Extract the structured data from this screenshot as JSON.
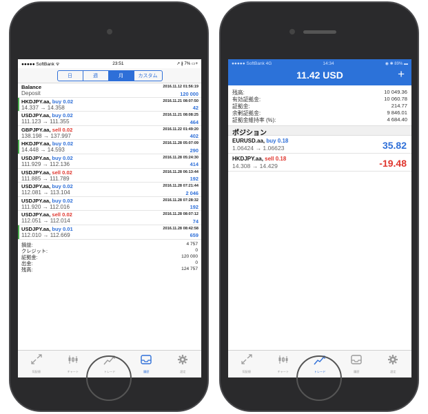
{
  "left": {
    "status": {
      "carrier": "●●●●● SoftBank ᯤ",
      "time": "23:51",
      "right": "↗ ∦ 7% ▭+"
    },
    "segments": [
      "日",
      "週",
      "月",
      "カスタム"
    ],
    "segment_active": 2,
    "balance": {
      "title": "Balance",
      "date": "2016.11.12 01:56:19",
      "sub": "Deposit",
      "amount": "120 000"
    },
    "trades": [
      {
        "sym": "HKDJPY.aa,",
        "side": "buy 0.02",
        "dir": "buy",
        "date": "2016.11.21 08:07:50",
        "prices": "14.337 → 14.358",
        "amt": "42",
        "mark": true
      },
      {
        "sym": "USDJPY.aa,",
        "side": "buy 0.02",
        "dir": "buy",
        "date": "2016.11.21 08:08:25",
        "prices": "111.123 → 111.355",
        "amt": "464",
        "mark": false
      },
      {
        "sym": "GBPJPY.aa,",
        "side": "sell 0.02",
        "dir": "sell",
        "date": "2016.11.22 01:49:20",
        "prices": "138.198 → 137.997",
        "amt": "402",
        "mark": false
      },
      {
        "sym": "HKDJPY.aa,",
        "side": "buy 0.02",
        "dir": "buy",
        "date": "2016.11.28 05:07:09",
        "prices": "14.448 → 14.593",
        "amt": "290",
        "mark": true
      },
      {
        "sym": "USDJPY.aa,",
        "side": "buy 0.02",
        "dir": "buy",
        "date": "2016.11.28 05:24:30",
        "prices": "111.929 → 112.136",
        "amt": "414",
        "mark": false
      },
      {
        "sym": "USDJPY.aa,",
        "side": "sell 0.02",
        "dir": "sell",
        "date": "2016.11.28 06:13:44",
        "prices": "111.885 → 111.789",
        "amt": "192",
        "mark": false
      },
      {
        "sym": "USDJPY.aa,",
        "side": "buy 0.02",
        "dir": "buy",
        "date": "2016.11.28 07:21:44",
        "prices": "112.081 → 113.104",
        "amt": "2 046",
        "mark": false
      },
      {
        "sym": "USDJPY.aa,",
        "side": "buy 0.02",
        "dir": "buy",
        "date": "2016.11.28 07:28:32",
        "prices": "111.920 → 112.016",
        "amt": "192",
        "mark": false
      },
      {
        "sym": "USDJPY.aa,",
        "side": "sell 0.02",
        "dir": "sell",
        "date": "2016.11.28 08:07:12",
        "prices": "112.051 → 112.014",
        "amt": "74",
        "mark": false
      },
      {
        "sym": "USDJPY.aa,",
        "side": "buy 0.01",
        "dir": "buy",
        "date": "2016.11.28 08:42:58",
        "prices": "112.010 → 112.669",
        "amt": "659",
        "mark": true
      }
    ],
    "summary": [
      {
        "k": "損益:",
        "v": "4 757"
      },
      {
        "k": "クレジット:",
        "v": "0"
      },
      {
        "k": "証拠金:",
        "v": "120 000"
      },
      {
        "k": "出金:",
        "v": "0"
      },
      {
        "k": "残高:",
        "v": "124 757"
      }
    ],
    "tabs": [
      "気配値",
      "チャート",
      "トレード",
      "履歴",
      "設定"
    ],
    "tab_active": 3
  },
  "right": {
    "status": {
      "carrier": "●●●●● SoftBank 4G",
      "time": "14:34",
      "right": "◉ ✱ 89% ▬"
    },
    "title": "11.42 USD",
    "plus": "+",
    "account": [
      {
        "k": "残高:",
        "v": "10 049.36"
      },
      {
        "k": "有効証拠金:",
        "v": "10 060.78"
      },
      {
        "k": "証拠金:",
        "v": "214.77"
      },
      {
        "k": "余剰証拠金:",
        "v": "9 846.01"
      },
      {
        "k": "証拠金維持率 (%):",
        "v": "4 684.40"
      }
    ],
    "positions_header": "ポジション",
    "positions": [
      {
        "sym": "EURUSD.aa,",
        "side": "buy 0.18",
        "dir": "buy",
        "prices": "1.06424 → 1.06623",
        "pl": "35.82",
        "sign": "pos"
      },
      {
        "sym": "HKDJPY.aa,",
        "side": "sell 0.18",
        "dir": "sell",
        "prices": "14.308 → 14.429",
        "pl": "-19.48",
        "sign": "neg"
      }
    ],
    "tabs": [
      "気配値",
      "チャート",
      "トレード",
      "履歴",
      "設定"
    ],
    "tab_active": 2
  }
}
